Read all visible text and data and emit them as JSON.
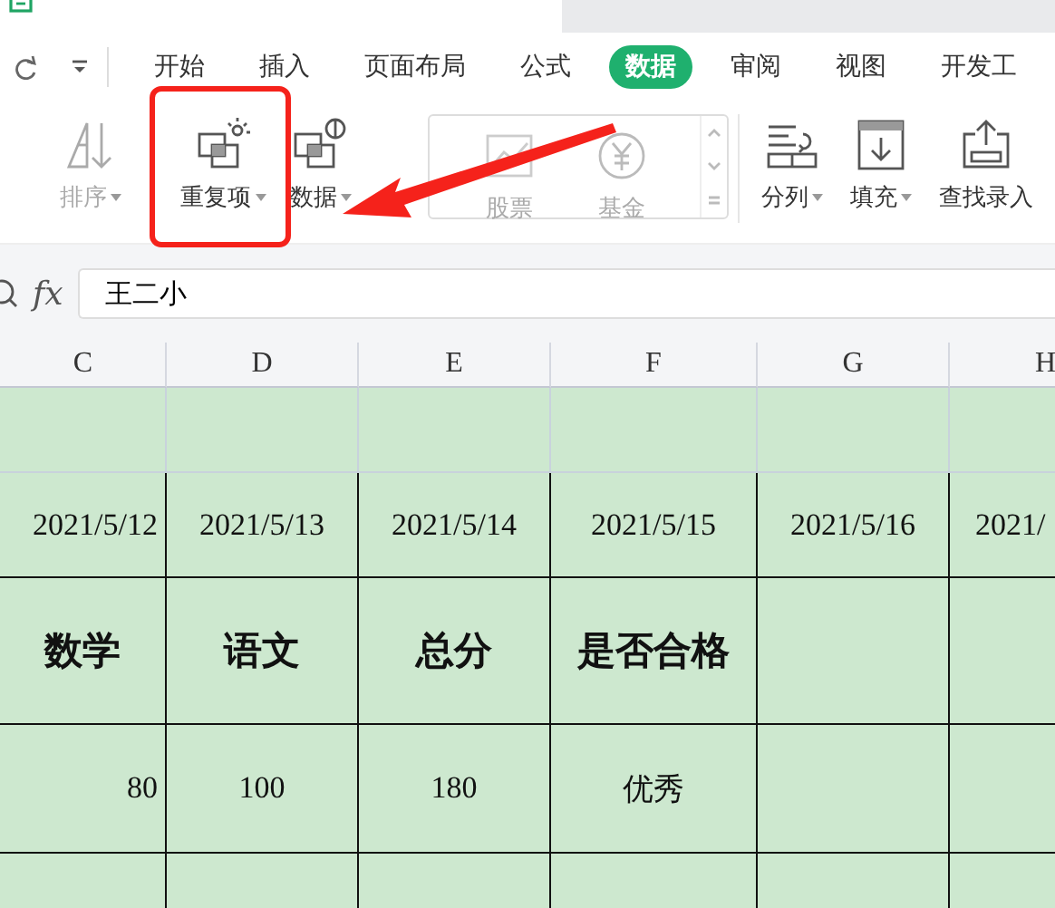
{
  "tabs": [
    {
      "label": "开始",
      "selected": false
    },
    {
      "label": "插入",
      "selected": false
    },
    {
      "label": "页面布局",
      "selected": false
    },
    {
      "label": "公式",
      "selected": false
    },
    {
      "label": "数据",
      "selected": true
    },
    {
      "label": "审阅",
      "selected": false
    },
    {
      "label": "视图",
      "selected": false
    },
    {
      "label": "开发工",
      "selected": false
    }
  ],
  "ribbon": [
    {
      "label": "排序",
      "kind": "sort",
      "disabled": true,
      "dropdown": true
    },
    {
      "label": "重复项",
      "kind": "duplicates",
      "disabled": false,
      "dropdown": true
    },
    {
      "label": "数据",
      "kind": "compare",
      "disabled": false,
      "dropdown": true
    },
    {
      "label": "股票",
      "kind": "stock",
      "disabled": true,
      "dropdown": false
    },
    {
      "label": "基金",
      "kind": "fund",
      "disabled": true,
      "dropdown": false
    },
    {
      "label": "分列",
      "kind": "split",
      "disabled": false,
      "dropdown": true
    },
    {
      "label": "填充",
      "kind": "fill",
      "disabled": false,
      "dropdown": true
    },
    {
      "label": "查找录入",
      "kind": "lookup",
      "disabled": false,
      "dropdown": false
    }
  ],
  "formula_bar": {
    "function_label": "fx",
    "value": "王二小"
  },
  "sheet": {
    "columns": [
      "C",
      "D",
      "E",
      "F",
      "G",
      "H"
    ],
    "rows": [
      {
        "bordered": false,
        "cells": [
          null,
          null,
          null,
          null,
          null,
          null
        ]
      },
      {
        "bordered": true,
        "bold": false,
        "cells": [
          "2021/5/12",
          "2021/5/13",
          "2021/5/14",
          "2021/5/15",
          "2021/5/16",
          "2021/"
        ]
      },
      {
        "bordered": true,
        "bold": true,
        "cells": [
          "数学",
          "语文",
          "总分",
          "是否合格",
          null,
          null
        ]
      },
      {
        "bordered": true,
        "bold": false,
        "cells": [
          "80",
          "100",
          "180",
          "优秀",
          null,
          null
        ]
      },
      {
        "bordered": true,
        "cells": [
          null,
          null,
          null,
          null,
          null,
          null
        ]
      }
    ]
  }
}
